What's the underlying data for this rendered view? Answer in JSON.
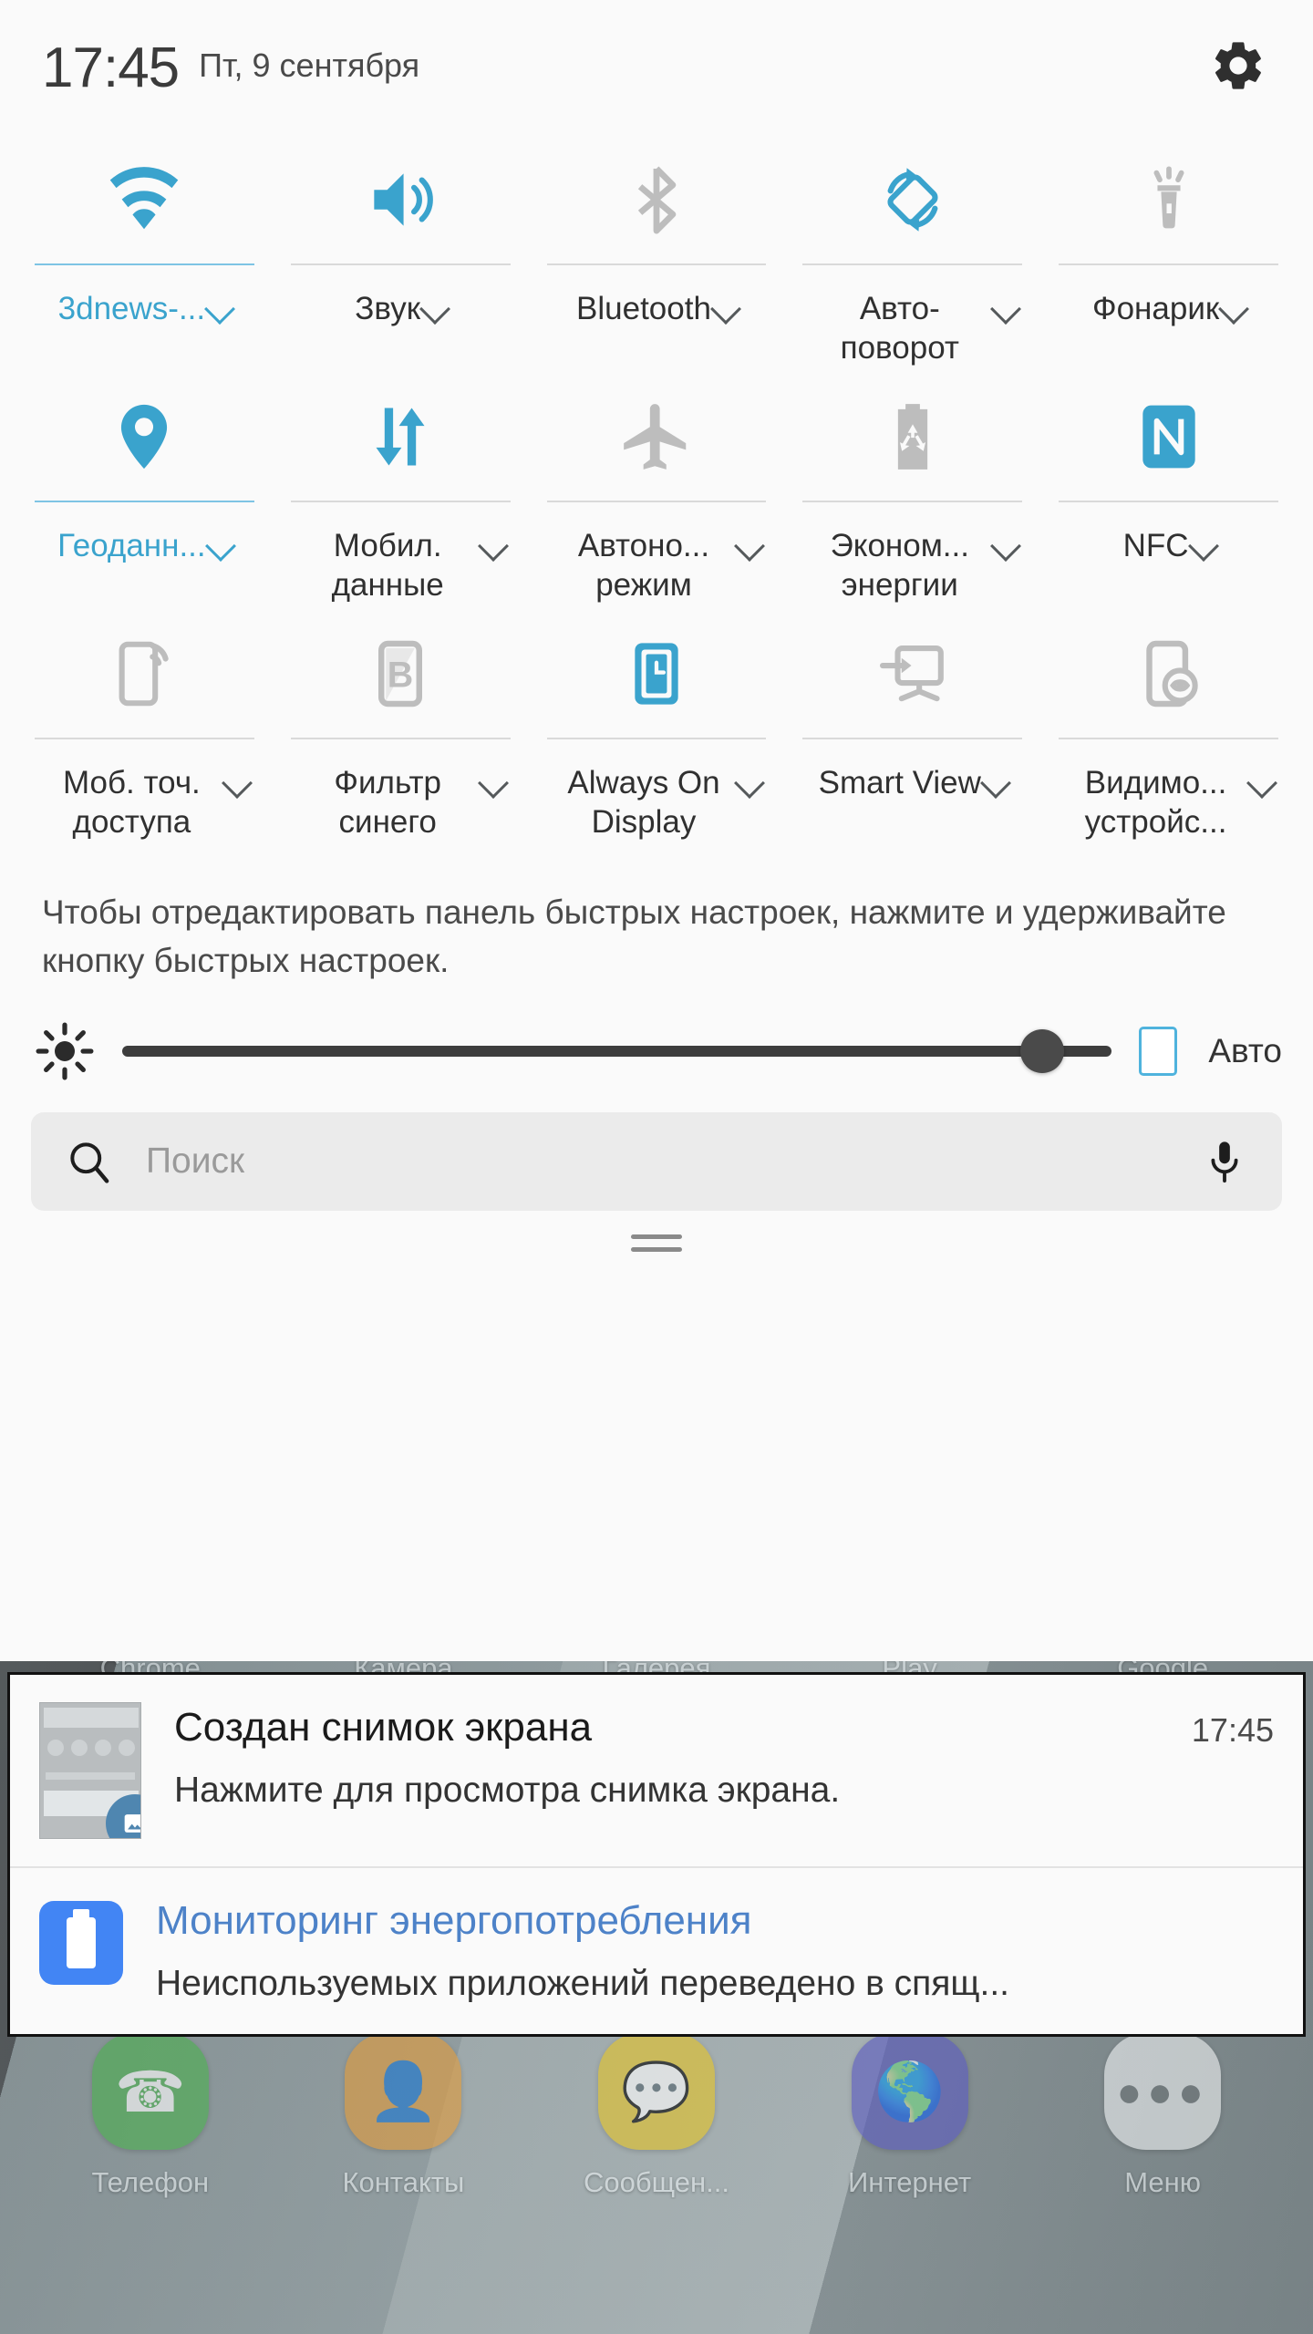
{
  "statusbar": {
    "time": "17:45",
    "date": "Пт, 9 сентября",
    "settings_icon": "gear-icon"
  },
  "quick_settings": {
    "tiles": [
      {
        "label": "3dnews-...",
        "icon": "wifi-icon",
        "active": true,
        "chevron": true
      },
      {
        "label": "Звук",
        "icon": "volume-icon",
        "active": true,
        "chevron": true
      },
      {
        "label": "Bluetooth",
        "icon": "bluetooth-icon",
        "active": false,
        "chevron": true
      },
      {
        "label": "Авто-поворот",
        "icon": "auto-rotate-icon",
        "active": true,
        "chevron": true
      },
      {
        "label": "Фонарик",
        "icon": "flashlight-icon",
        "active": false,
        "chevron": true
      },
      {
        "label": "Геоданн...",
        "icon": "location-pin-icon",
        "active": true,
        "chevron": true
      },
      {
        "label": "Мобил. данные",
        "icon": "mobile-data-icon",
        "active": true,
        "chevron": true
      },
      {
        "label": "Автоно... режим",
        "icon": "airplane-icon",
        "active": false,
        "chevron": true
      },
      {
        "label": "Эконом... энергии",
        "icon": "power-saving-icon",
        "active": false,
        "chevron": true
      },
      {
        "label": "NFC",
        "icon": "nfc-icon",
        "active": true,
        "chevron": true
      },
      {
        "label": "Моб. точ. доступа",
        "icon": "hotspot-icon",
        "active": false,
        "chevron": true
      },
      {
        "label": "Фильтр синего",
        "icon": "blue-light-filter-icon",
        "active": false,
        "chevron": true
      },
      {
        "label": "Always On Display",
        "icon": "always-on-display-icon",
        "active": true,
        "chevron": true
      },
      {
        "label": "Smart View",
        "icon": "smart-view-icon",
        "active": false,
        "chevron": true
      },
      {
        "label": "Видимо... устройс...",
        "icon": "device-visibility-icon",
        "active": false,
        "chevron": true
      }
    ],
    "edit_hint": "Чтобы отредактировать панель быстрых настроек, нажмите и удерживайте кнопку быстрых настроек."
  },
  "brightness": {
    "icon": "brightness-icon",
    "value_percent": 93,
    "auto_label": "Авто",
    "auto_checked": false
  },
  "search": {
    "placeholder": "Поиск",
    "search_icon": "search-icon",
    "mic_icon": "microphone-icon"
  },
  "notifications": [
    {
      "title": "Создан снимок экрана",
      "text": "Нажмите для просмотра снимка экрана.",
      "time": "17:45",
      "icon": "screenshot-thumbnail",
      "badge_icon": "image-icon"
    },
    {
      "title": "Мониторинг энергопотребления",
      "text": "Неиспользуемых приложений переведено в спящ...",
      "time": "",
      "icon": "battery-app-icon"
    }
  ],
  "home_screen": {
    "upper_row_labels": [
      "Chrome",
      "Камера",
      "Галерея",
      "Play",
      "Google"
    ],
    "dock": [
      {
        "label": "Телефон",
        "icon": "phone-icon",
        "color": "#4caf50"
      },
      {
        "label": "Контакты",
        "icon": "contacts-icon",
        "color": "#e09b3d"
      },
      {
        "label": "Сообщен...",
        "icon": "messages-icon",
        "color": "#e3c32a"
      },
      {
        "label": "Интернет",
        "icon": "browser-icon",
        "color": "#5b5bbf"
      },
      {
        "label": "Меню",
        "icon": "apps-menu-icon",
        "color": "#eceff0"
      }
    ]
  },
  "colors": {
    "accent": "#3aa3cd",
    "inactive": "#bdbdbd",
    "panel_bg": "#fafafa",
    "notif_link": "#4d82c8"
  }
}
